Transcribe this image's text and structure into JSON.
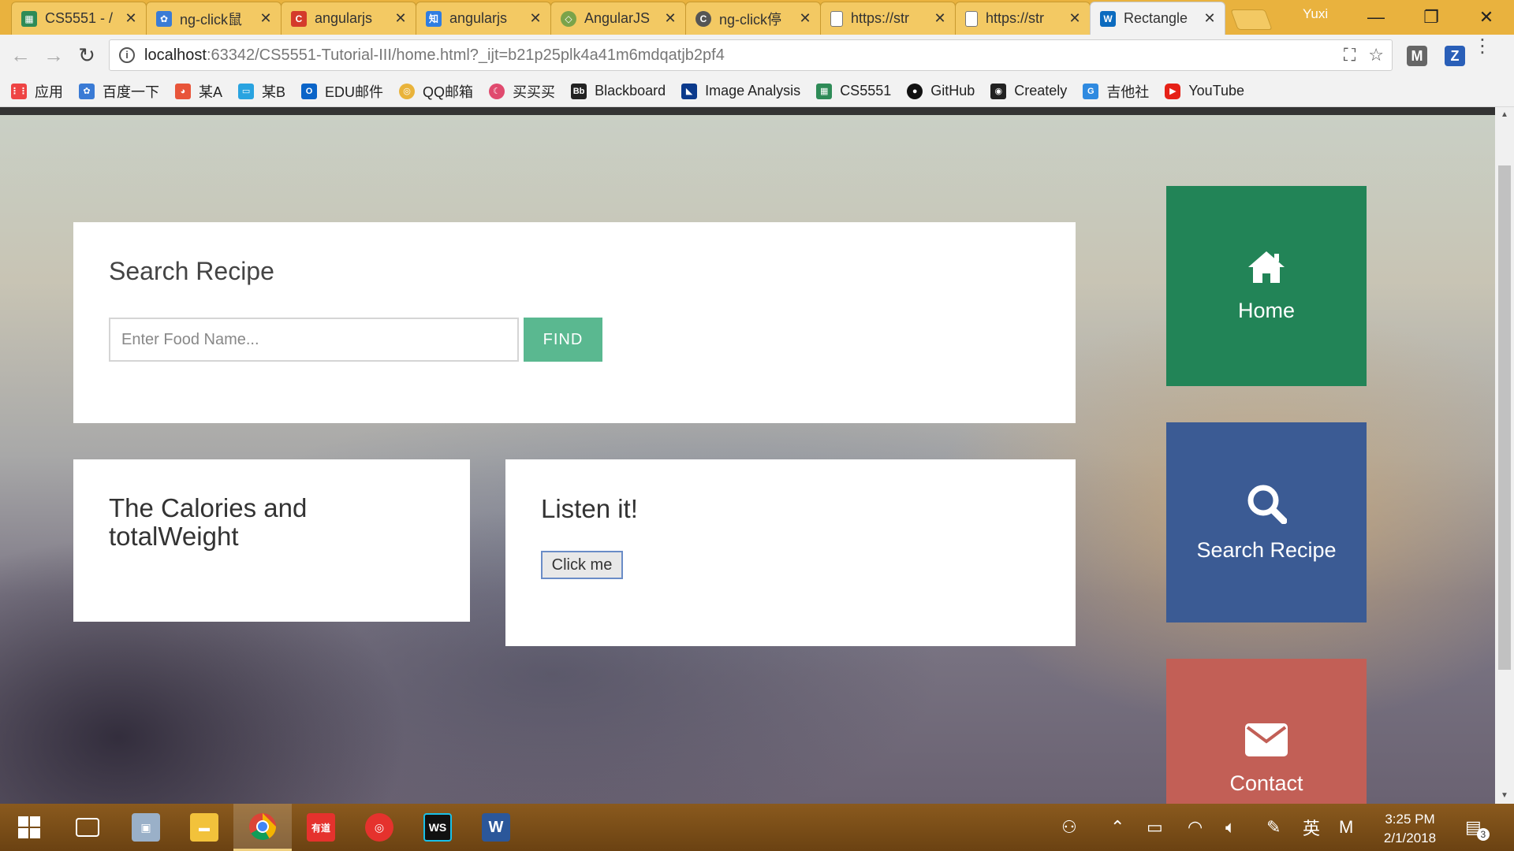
{
  "tabs": [
    {
      "title": "CS5551 - /",
      "icon": "spreadsheet-icon",
      "color": "#2e8b57"
    },
    {
      "title": "ng-click鼠",
      "icon": "paw-icon",
      "color": "#3a7bd5"
    },
    {
      "title": "angularjs",
      "icon": "c-logo-icon",
      "color": "#d43b2b"
    },
    {
      "title": "angularjs",
      "icon": "zhihu-icon",
      "color": "#2f7de1"
    },
    {
      "title": "AngularJS",
      "icon": "runoob-icon",
      "color": "#7aa34a"
    },
    {
      "title": "ng-click停",
      "icon": "c-round-icon",
      "color": "#555555"
    },
    {
      "title": "https://str",
      "icon": "page-icon",
      "color": "#ffffff"
    },
    {
      "title": "https://str",
      "icon": "page-icon",
      "color": "#ffffff"
    },
    {
      "title": "Rectangle",
      "icon": "webstorm-icon",
      "color": "#0b6bbf"
    }
  ],
  "profile": {
    "name": "Yuxi"
  },
  "window": {
    "minimize": "—",
    "restore": "❐",
    "close": "✕"
  },
  "address": {
    "host": "localhost",
    "rest": ":63342/CS5551-Tutorial-III/home.html?_ijt=b21p25plk4a41m6mdqatjb2pf4"
  },
  "bookmarks": [
    {
      "label": "应用",
      "icon": "apps-grid-icon",
      "color": "#e44"
    },
    {
      "label": "百度一下",
      "icon": "baidu-paw-icon",
      "color": "#3a7bd5"
    },
    {
      "label": "某A",
      "icon": "cat-face-icon",
      "color": "#e8553a"
    },
    {
      "label": "某B",
      "icon": "tv-icon",
      "color": "#29a3e0"
    },
    {
      "label": "EDU邮件",
      "icon": "outlook-icon",
      "color": "#0a64c8"
    },
    {
      "label": "QQ邮箱",
      "icon": "qq-mail-icon",
      "color": "#e9b33a"
    },
    {
      "label": "买买买",
      "icon": "moon-icon",
      "color": "#e04a6e"
    },
    {
      "label": "Blackboard",
      "icon": "blackboard-icon",
      "color": "#222222"
    },
    {
      "label": "Image Analysis",
      "icon": "ia-logo-icon",
      "color": "#0b3a8c"
    },
    {
      "label": "CS5551",
      "icon": "spreadsheet-icon",
      "color": "#2e8b57"
    },
    {
      "label": "GitHub",
      "icon": "github-icon",
      "color": "#111111"
    },
    {
      "label": "Creately",
      "icon": "bulb-icon",
      "color": "#222222"
    },
    {
      "label": "吉他社",
      "icon": "g-logo-icon",
      "color": "#2f8ae0"
    },
    {
      "label": "YouTube",
      "icon": "youtube-icon",
      "color": "#e62117"
    }
  ],
  "page": {
    "search": {
      "title": "Search Recipe",
      "placeholder": "Enter Food Name...",
      "find_label": "FIND"
    },
    "calories": {
      "title": "The Calories and totalWeight"
    },
    "listen": {
      "title": "Listen it!",
      "button_label": "Click me"
    },
    "tiles": [
      {
        "label": "Home",
        "icon": "home-icon",
        "color": "#228457"
      },
      {
        "label": "Search Recipe",
        "icon": "search-icon",
        "color": "#3b5b94"
      },
      {
        "label": "Contact",
        "icon": "envelope-icon",
        "color": "#c25f56"
      }
    ]
  },
  "taskbar": {
    "apps": [
      {
        "icon": "windows-start-icon"
      },
      {
        "icon": "task-view-icon"
      },
      {
        "icon": "network-pc-icon"
      },
      {
        "icon": "file-explorer-icon"
      },
      {
        "icon": "chrome-icon"
      },
      {
        "icon": "youdao-icon",
        "label": "有道"
      },
      {
        "icon": "netease-music-icon"
      },
      {
        "icon": "webstorm-icon",
        "label": "WS"
      },
      {
        "icon": "word-icon",
        "label": "W"
      }
    ],
    "tray_ime": "英",
    "tray_m": "M",
    "time": "3:25 PM",
    "date": "2/1/2018",
    "notifications": "3"
  }
}
